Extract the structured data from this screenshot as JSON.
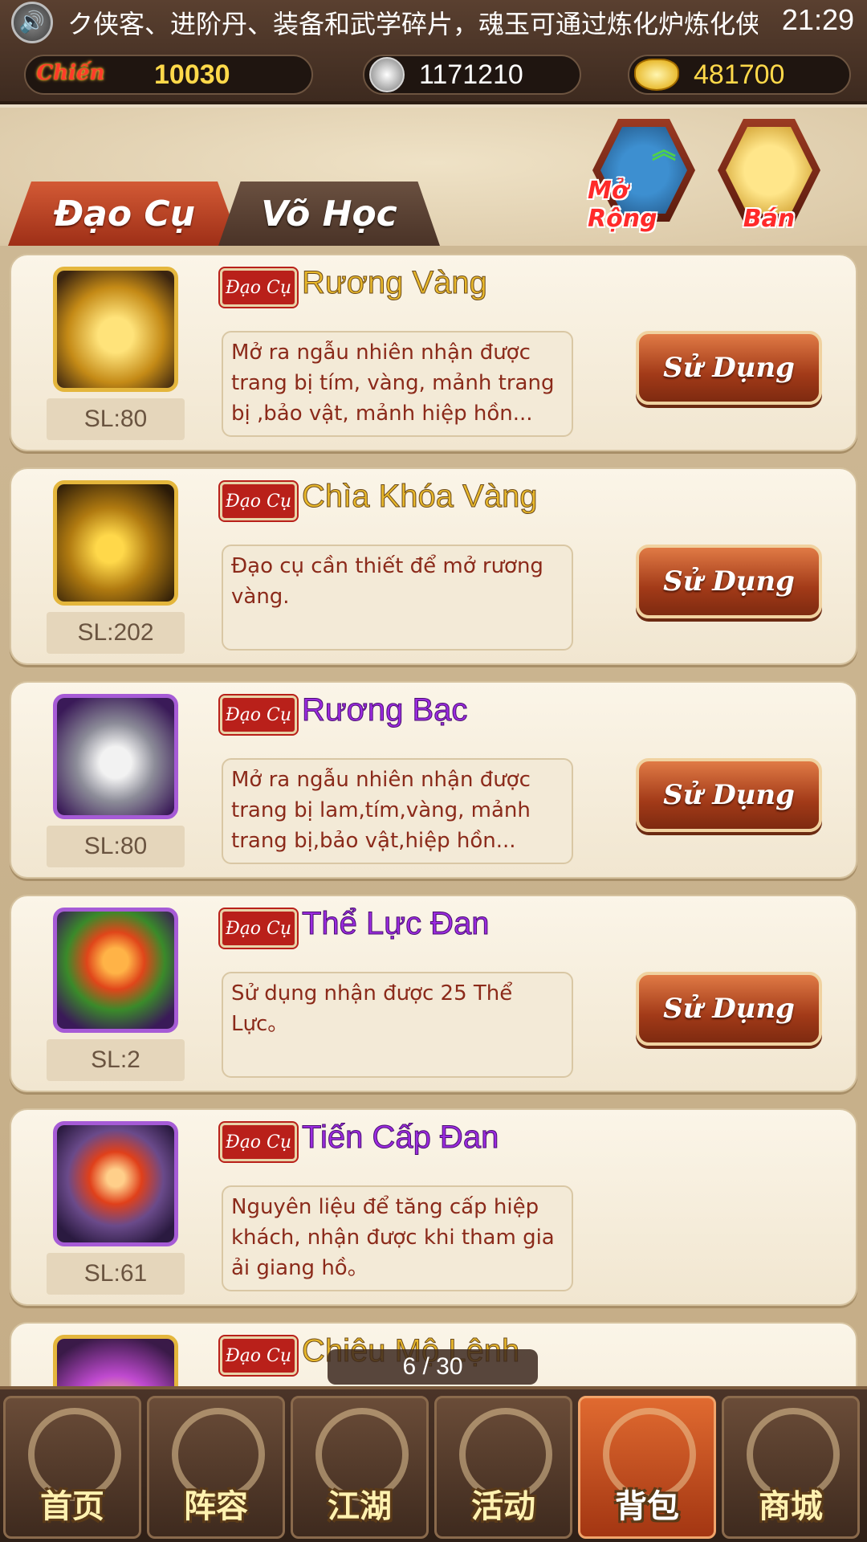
{
  "status_bar": {
    "marquee": "ク侠客、进阶丹、装备和武学碎片，魂玉可通过炼化炉炼化侠客",
    "time": "21:29"
  },
  "resources": {
    "power_label": "Chiến",
    "power": "10030",
    "silver": "1171210",
    "gold": "481700"
  },
  "tabs": {
    "items": "Đạo Cụ",
    "martial": "Võ Học"
  },
  "actions": {
    "expand": "Mở Rộng",
    "sell": "Bán"
  },
  "item_tag": "Đạo Cụ",
  "use_label": "Sử Dụng",
  "items": [
    {
      "name": "Rương Vàng",
      "qty": "SL:80",
      "desc": "Mở ra ngẫu nhiên nhận được trang bị tím, vàng, mảnh trang bị ,bảo vật, mảnh hiệp hồn..."
    },
    {
      "name": "Chìa Khóa Vàng",
      "qty": "SL:202",
      "desc": "Đạo cụ cần thiết để mở rương vàng."
    },
    {
      "name": "Rương Bạc",
      "qty": "SL:80",
      "desc": "Mở ra ngẫu nhiên nhận được trang bị lam,tím,vàng, mảnh trang bị,bảo vật,hiệp hồn..."
    },
    {
      "name": "Thể Lực Đan",
      "qty": "SL:2",
      "desc": "Sử dụng nhận được 25 Thể Lực。"
    },
    {
      "name": "Tiến Cấp Đan",
      "qty": "SL:61",
      "desc": "Nguyên liệu để tăng cấp hiệp khách, nhận được khi tham gia ải giang hồ。"
    },
    {
      "name": "Chiêu Mộ Lệnh",
      "qty": "",
      "desc": ""
    }
  ],
  "pager": "6 / 30",
  "nav": [
    "首页",
    "阵容",
    "江湖",
    "活动",
    "背包",
    "商城"
  ],
  "colors": {
    "gold_name": "#e8b82b",
    "purple_name": "#9b2be0",
    "tag_red": "#b9201a",
    "active_tab": "#c44a26"
  }
}
